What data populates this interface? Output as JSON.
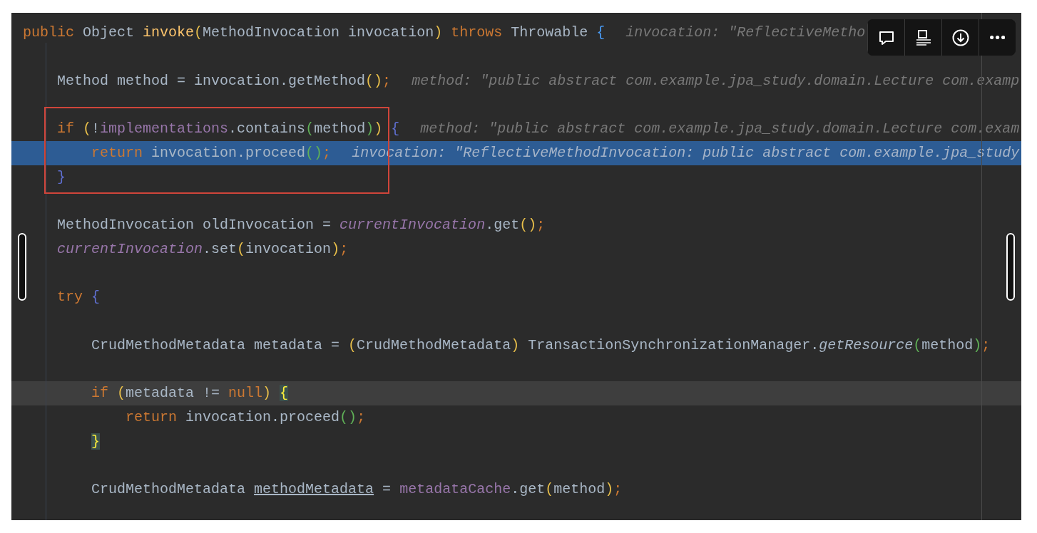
{
  "editor": {
    "lines": [
      {
        "execution": false,
        "caret": false,
        "boxed": false,
        "tokens": [
          {
            "kind": "keyword",
            "text": "public"
          },
          {
            "kind": "plain",
            "text": " Object "
          },
          {
            "kind": "declaration",
            "text": "invoke"
          },
          {
            "kind": "paren",
            "text": "("
          },
          {
            "kind": "plain",
            "text": "MethodInvocation invocation"
          },
          {
            "kind": "paren",
            "text": ") "
          },
          {
            "kind": "keyword",
            "text": "throws"
          },
          {
            "kind": "plain",
            "text": " Throwable "
          },
          {
            "kind": "outer-brace",
            "text": "{"
          }
        ],
        "hint": "invocation: \"ReflectiveMetho"
      },
      {
        "execution": false,
        "caret": false,
        "boxed": false
      },
      {
        "execution": false,
        "caret": false,
        "boxed": false,
        "tokens": [
          {
            "kind": "plain",
            "text": "    Method method = invocation.getMethod"
          },
          {
            "kind": "paren",
            "text": "()"
          },
          {
            "kind": "semicolon",
            "text": ";"
          }
        ],
        "hint": "method: \"public abstract com.example.jpa_study.domain.Lecture com.examp"
      },
      {
        "execution": false,
        "caret": false,
        "boxed": false
      },
      {
        "execution": false,
        "caret": false,
        "boxed": true,
        "tokens": [
          {
            "kind": "keyword",
            "text": "    if "
          },
          {
            "kind": "paren",
            "text": "("
          },
          {
            "kind": "plain",
            "text": "!"
          },
          {
            "kind": "field",
            "text": "implementations"
          },
          {
            "kind": "plain",
            "text": ".contains"
          },
          {
            "kind": "inner-paren",
            "text": "("
          },
          {
            "kind": "plain",
            "text": "method"
          },
          {
            "kind": "inner-paren",
            "text": ")"
          },
          {
            "kind": "paren",
            "text": ") "
          },
          {
            "kind": "brace",
            "text": "{"
          }
        ],
        "hint": "method: \"public abstract com.example.jpa_study.domain.Lecture com.exam"
      },
      {
        "execution": true,
        "caret": false,
        "boxed": true,
        "tokens": [
          {
            "kind": "keyword",
            "text": "        return"
          },
          {
            "kind": "plain",
            "text": " invocation.proceed"
          },
          {
            "kind": "inner-paren",
            "text": "()"
          },
          {
            "kind": "semicolon",
            "text": ";"
          }
        ],
        "hint": "invocation: \"ReflectiveMethodInvocation: public abstract com.example.jpa_study"
      },
      {
        "execution": false,
        "caret": false,
        "boxed": true,
        "tokens": [
          {
            "kind": "brace",
            "text": "    }"
          }
        ]
      },
      {
        "execution": false,
        "caret": false,
        "boxed": false
      },
      {
        "execution": false,
        "caret": false,
        "boxed": false,
        "tokens": [
          {
            "kind": "plain",
            "text": "    MethodInvocation oldInvocation = "
          },
          {
            "kind": "static",
            "text": "currentInvocation"
          },
          {
            "kind": "plain",
            "text": ".get"
          },
          {
            "kind": "paren",
            "text": "()"
          },
          {
            "kind": "semicolon",
            "text": ";"
          }
        ]
      },
      {
        "execution": false,
        "caret": false,
        "boxed": false,
        "tokens": [
          {
            "kind": "static",
            "text": "    currentInvocation"
          },
          {
            "kind": "plain",
            "text": ".set"
          },
          {
            "kind": "paren",
            "text": "("
          },
          {
            "kind": "plain",
            "text": "invocation"
          },
          {
            "kind": "paren",
            "text": ")"
          },
          {
            "kind": "semicolon",
            "text": ";"
          }
        ]
      },
      {
        "execution": false,
        "caret": false,
        "boxed": false
      },
      {
        "execution": false,
        "caret": false,
        "boxed": false,
        "tokens": [
          {
            "kind": "keyword",
            "text": "    try "
          },
          {
            "kind": "brace",
            "text": "{"
          }
        ]
      },
      {
        "execution": false,
        "caret": false,
        "boxed": false
      },
      {
        "execution": false,
        "caret": false,
        "boxed": false,
        "tokens": [
          {
            "kind": "plain",
            "text": "        CrudMethodMetadata metadata = "
          },
          {
            "kind": "paren",
            "text": "("
          },
          {
            "kind": "plain",
            "text": "CrudMethodMetadata"
          },
          {
            "kind": "paren",
            "text": ")"
          },
          {
            "kind": "plain",
            "text": " TransactionSynchronizationManager."
          },
          {
            "kind": "static-call",
            "text": "getResource"
          },
          {
            "kind": "inner-paren",
            "text": "("
          },
          {
            "kind": "plain",
            "text": "method"
          },
          {
            "kind": "inner-paren",
            "text": ")"
          },
          {
            "kind": "semicolon",
            "text": ";"
          }
        ]
      },
      {
        "execution": false,
        "caret": false,
        "boxed": false
      },
      {
        "execution": false,
        "caret": true,
        "boxed": false,
        "tokens": [
          {
            "kind": "keyword",
            "text": "        if "
          },
          {
            "kind": "paren",
            "text": "("
          },
          {
            "kind": "plain",
            "text": "metadata != "
          },
          {
            "kind": "keyword",
            "text": "null"
          },
          {
            "kind": "paren",
            "text": ") "
          },
          {
            "kind": "matched-brace",
            "text": "{"
          }
        ]
      },
      {
        "execution": false,
        "caret": false,
        "boxed": false,
        "tokens": [
          {
            "kind": "keyword",
            "text": "            return"
          },
          {
            "kind": "plain",
            "text": " invocation.proceed"
          },
          {
            "kind": "inner-paren",
            "text": "()"
          },
          {
            "kind": "semicolon",
            "text": ";"
          }
        ]
      },
      {
        "execution": false,
        "caret": false,
        "boxed": false,
        "tokens": [
          {
            "kind": "matched-brace",
            "text": "        }"
          }
        ]
      },
      {
        "execution": false,
        "caret": false,
        "boxed": false
      },
      {
        "execution": false,
        "caret": false,
        "boxed": false,
        "tokens": [
          {
            "kind": "plain",
            "text": "        CrudMethodMetadata "
          },
          {
            "kind": "underlined",
            "text": "methodMetadata"
          },
          {
            "kind": "plain",
            "text": " = "
          },
          {
            "kind": "field",
            "text": "metadataCache"
          },
          {
            "kind": "plain",
            "text": ".get"
          },
          {
            "kind": "paren",
            "text": "("
          },
          {
            "kind": "plain",
            "text": "method"
          },
          {
            "kind": "paren",
            "text": ")"
          },
          {
            "kind": "semicolon",
            "text": ";"
          }
        ]
      }
    ]
  },
  "toolbar": {
    "buttons": [
      {
        "kind": "comment"
      },
      {
        "kind": "layout"
      },
      {
        "kind": "download"
      },
      {
        "kind": "more"
      }
    ]
  }
}
